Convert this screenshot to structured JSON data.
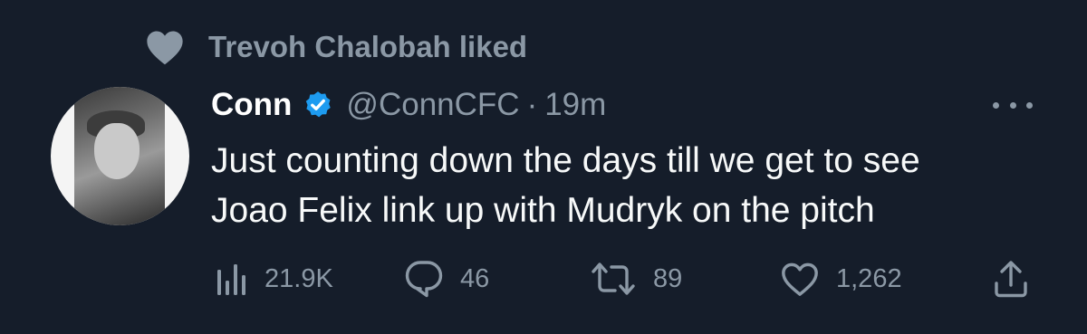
{
  "social_context": {
    "icon": "heart-icon",
    "text": "Trevoh Chalobah liked"
  },
  "tweet": {
    "display_name": "Conn",
    "verified_icon": "verified-badge-icon",
    "handle": "@ConnCFC",
    "separator": "·",
    "timestamp": "19m",
    "text_lines": [
      "Just counting down the days till we get to see",
      "Joao Felix link up with Mudryk on the pitch"
    ]
  },
  "actions": {
    "views": {
      "icon": "views-chart-icon",
      "count": "21.9K"
    },
    "replies": {
      "icon": "reply-icon",
      "count": "46"
    },
    "retweets": {
      "icon": "retweet-icon",
      "count": "89"
    },
    "likes": {
      "icon": "heart-outline-icon",
      "count": "1,262"
    },
    "share": {
      "icon": "share-icon"
    }
  },
  "colors": {
    "background": "#151d2a",
    "primary_text": "#f7f9f9",
    "secondary_text": "#8b98a5",
    "verified_blue": "#1d9bf0"
  }
}
